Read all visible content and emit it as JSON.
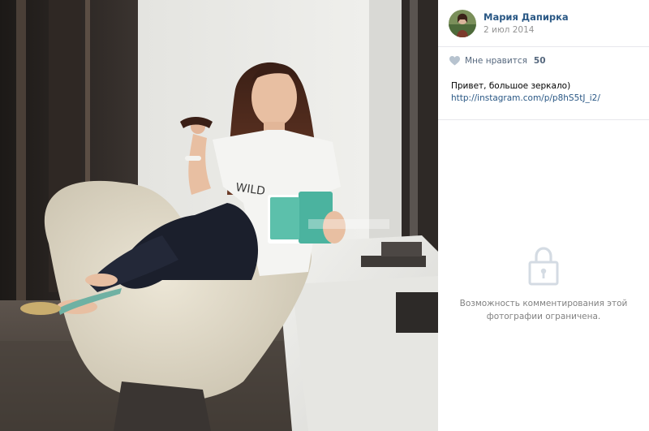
{
  "author": {
    "name": "Мария Дапирка",
    "date": "2 июл 2014"
  },
  "likes": {
    "label": "Мне нравится",
    "count": "50",
    "icon": "heart-icon"
  },
  "post": {
    "text": "Привет, большое зеркало)",
    "link": "http://instagram.com/p/p8hS5tJ_i2/"
  },
  "comments": {
    "icon": "lock-icon",
    "message": "Возможность комментирования этой фотографии ограничена."
  },
  "colors": {
    "link": "#2a5885",
    "muted": "#939393",
    "divider": "#e7e8ec"
  }
}
